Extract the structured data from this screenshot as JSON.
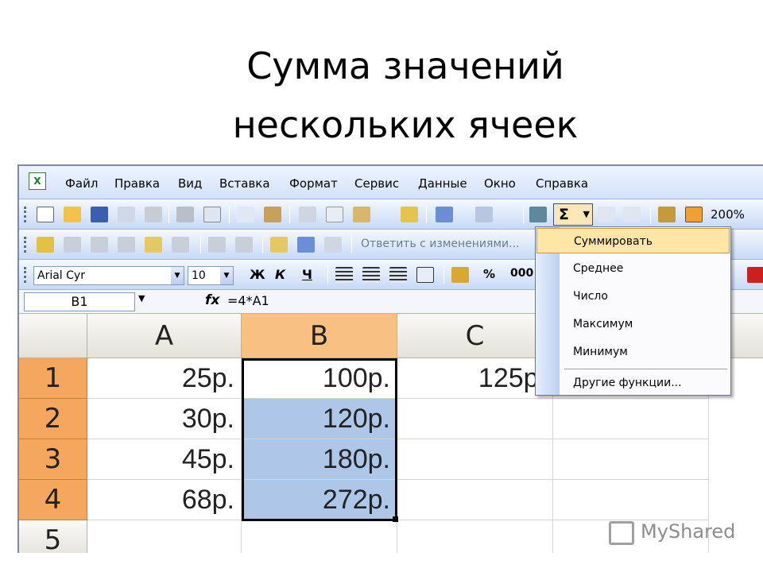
{
  "slide": {
    "title_line1": "Сумма значений",
    "title_line2": "нескольких ячеек"
  },
  "menubar": {
    "items": [
      "Файл",
      "Правка",
      "Вид",
      "Вставка",
      "Формат",
      "Сервис",
      "Данные",
      "Окно",
      "Справка"
    ]
  },
  "toolbar": {
    "autosum_symbol": "Σ",
    "zoom": "200%",
    "reply_label": "Ответить с изменениями...",
    "font_name": "Arial Cyr",
    "font_size": "10",
    "bold": "Ж",
    "italic": "К",
    "underline": "Ч",
    "percent": "%",
    "thousands": "000"
  },
  "formula_bar": {
    "name_box": "B1",
    "fx": "fx",
    "formula": "=4*A1"
  },
  "grid": {
    "columns": [
      "A",
      "B",
      "C"
    ],
    "rows": [
      "1",
      "2",
      "3",
      "4",
      "5"
    ],
    "cells": {
      "A1": "25р.",
      "B1": "100р.",
      "C1": "125р.",
      "A2": "30р.",
      "B2": "120р.",
      "A3": "45р.",
      "B3": "180р.",
      "A4": "68р.",
      "B4": "272р."
    }
  },
  "autosum_menu": {
    "items": [
      "Суммировать",
      "Среднее",
      "Число",
      "Максимум",
      "Минимум",
      "Другие функции..."
    ],
    "highlighted": "Суммировать"
  },
  "watermark": "MyShared",
  "colors": {
    "selected_header": "#f6a75e",
    "selected_range": "#aec6e8",
    "menu_highlight": "#ffe6a6"
  }
}
